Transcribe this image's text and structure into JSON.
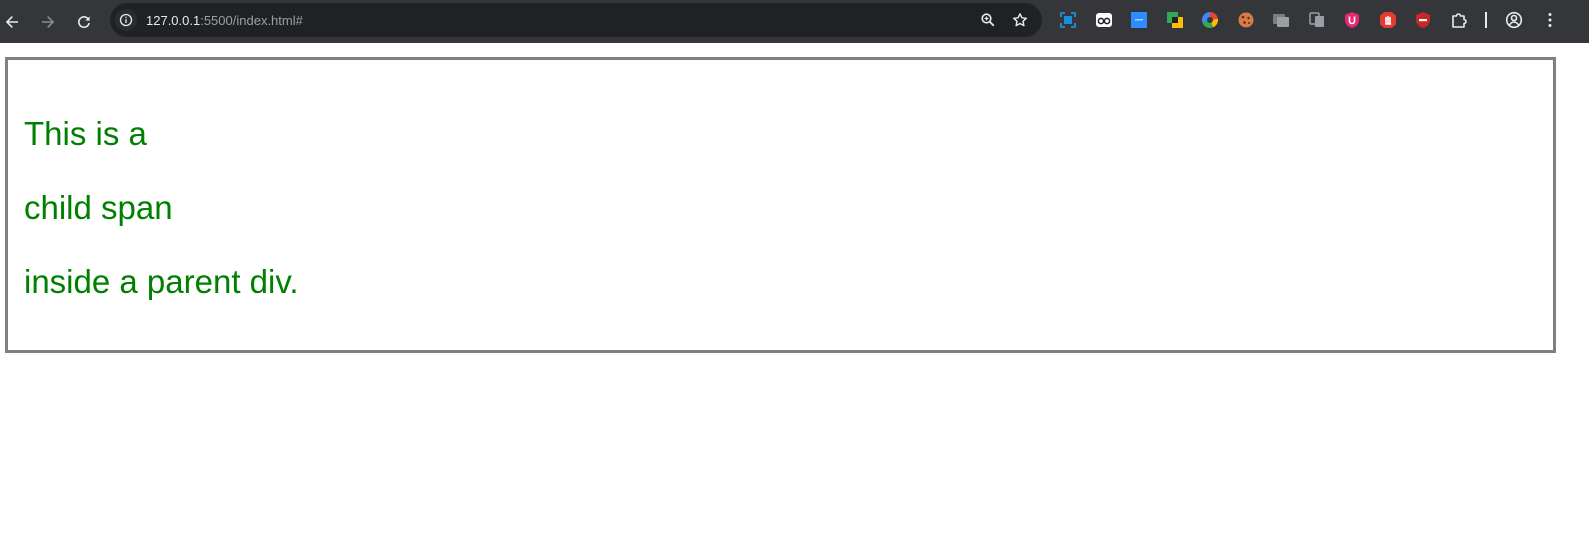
{
  "browser": {
    "nav": {
      "back_icon": "arrow-left-icon",
      "forward_icon": "arrow-right-icon",
      "reload_icon": "reload-icon"
    },
    "omnibox": {
      "site_info_icon": "info-icon",
      "url_host": "127.0.0.1",
      "url_rest": ":5500/index.html#",
      "zoom_icon": "zoom-icon",
      "bookmark_icon": "star-icon"
    },
    "extensions": [
      {
        "name": "screen-capture-extension-icon",
        "color": "#1a8fd6"
      },
      {
        "name": "eyes-extension-icon",
        "color": "#ffffff"
      },
      {
        "name": "blue-square-extension-icon",
        "color": "#2d8cff"
      },
      {
        "name": "overlap-squares-extension-icon",
        "color": "#34a853"
      },
      {
        "name": "color-wheel-extension-icon",
        "color": "#4285f4"
      },
      {
        "name": "cookie-extension-icon",
        "color": "#d97a4a"
      },
      {
        "name": "tabs-extension-icon",
        "color": "#9aa0a6"
      },
      {
        "name": "copy-extension-icon",
        "color": "#9aa0a6"
      },
      {
        "name": "shield-u-extension-icon",
        "color": "#e62873"
      },
      {
        "name": "hand-stop-extension-icon",
        "color": "#e53935"
      },
      {
        "name": "block-shield-extension-icon",
        "color": "#c62828"
      },
      {
        "name": "puzzle-extensions-icon",
        "color": "#e8eaed"
      }
    ],
    "profile_icon": "profile-icon",
    "menu_icon": "kebab-menu-icon"
  },
  "page": {
    "lines": [
      "This is a",
      "child span",
      "inside a parent div."
    ],
    "text_color": "#008000",
    "border_color": "#808080"
  }
}
